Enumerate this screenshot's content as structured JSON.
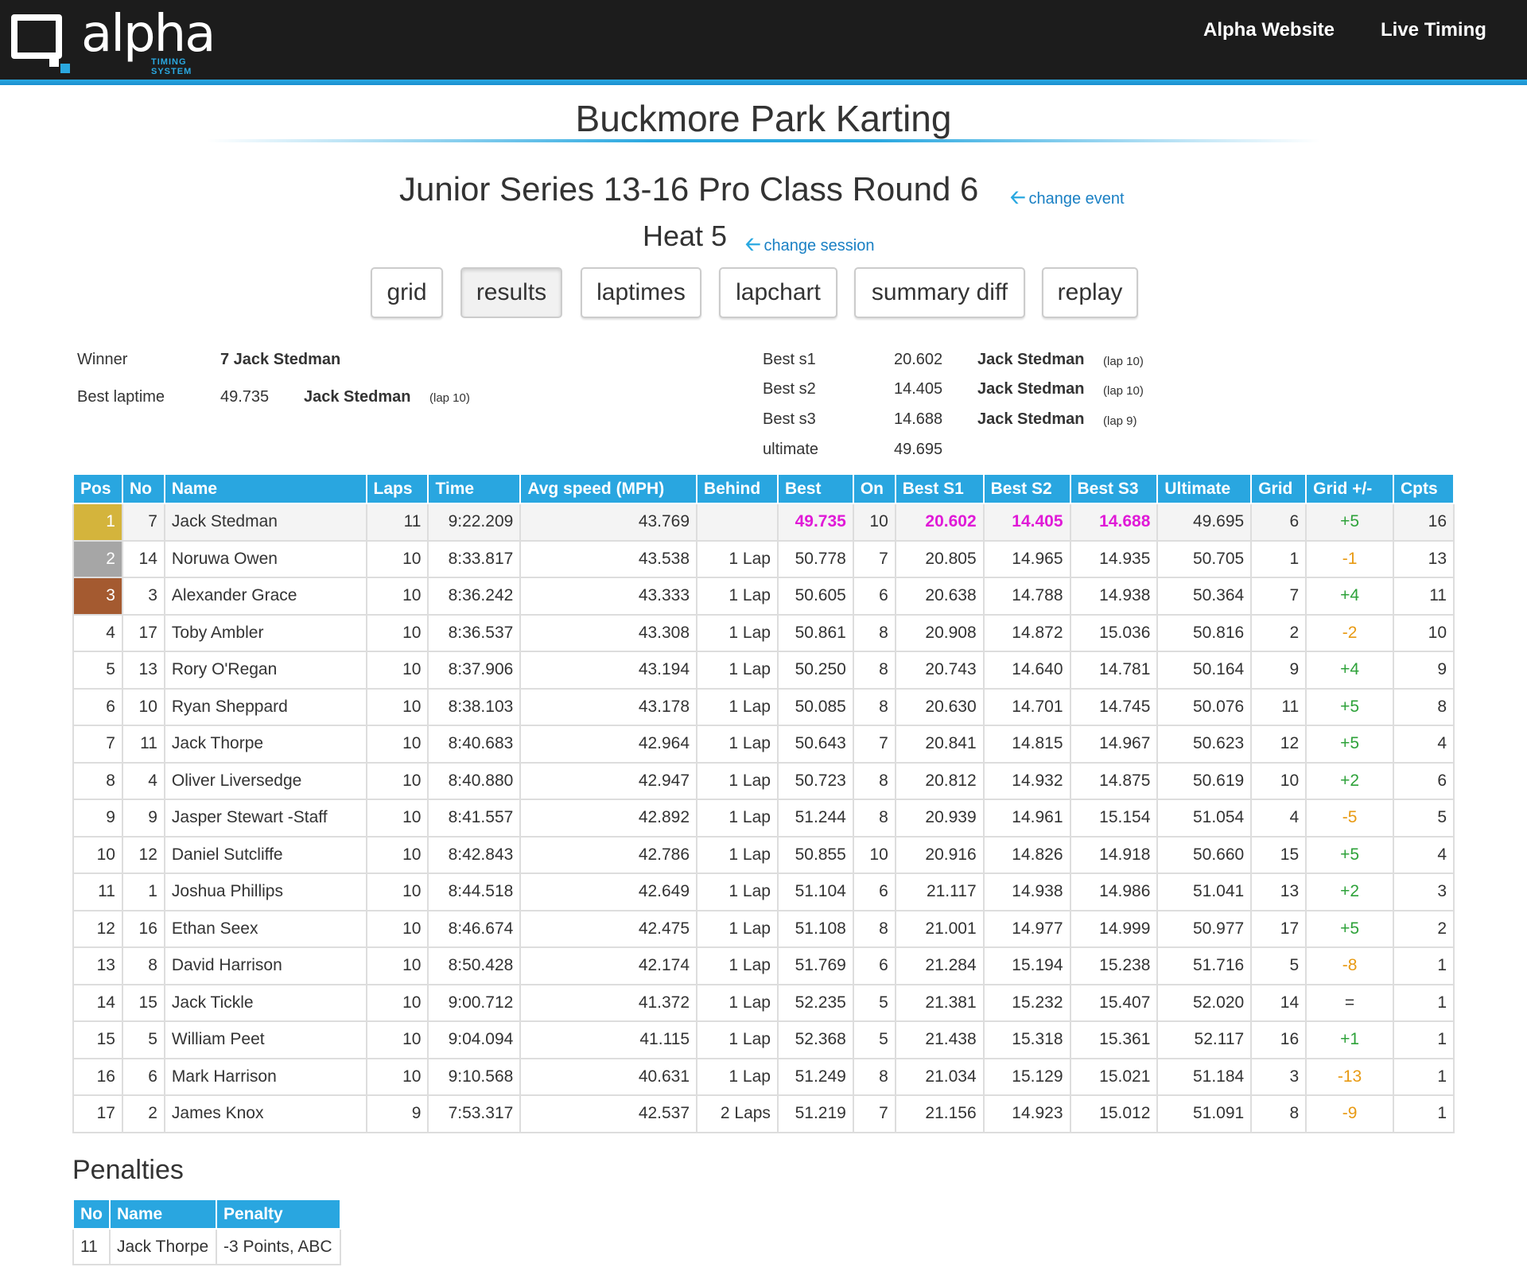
{
  "brand": {
    "logo_text": "alpha",
    "logo_subtext": "TIMING SYSTEM"
  },
  "nav": {
    "alpha_website": "Alpha Website",
    "live_timing": "Live Timing"
  },
  "venue": "Buckmore Park Karting",
  "event": {
    "title": "Junior Series 13-16 Pro Class Round 6",
    "change_label": "change event"
  },
  "session": {
    "title": "Heat 5",
    "change_label": "change session"
  },
  "tabs": [
    {
      "label": "grid",
      "active": false
    },
    {
      "label": "results",
      "active": true
    },
    {
      "label": "laptimes",
      "active": false
    },
    {
      "label": "lapchart",
      "active": false
    },
    {
      "label": "summary diff",
      "active": false
    },
    {
      "label": "replay",
      "active": false
    }
  ],
  "summary": {
    "winner_label": "Winner",
    "winner_value": "7 Jack Stedman",
    "best_laptime_label": "Best laptime",
    "best_laptime_value": "49.735",
    "best_laptime_driver": "Jack Stedman",
    "best_laptime_lap": "(lap 10)",
    "best_s1_label": "Best s1",
    "best_s1_value": "20.602",
    "best_s1_driver": "Jack Stedman",
    "best_s1_lap": "(lap 10)",
    "best_s2_label": "Best s2",
    "best_s2_value": "14.405",
    "best_s2_driver": "Jack Stedman",
    "best_s2_lap": "(lap 10)",
    "best_s3_label": "Best s3",
    "best_s3_value": "14.688",
    "best_s3_driver": "Jack Stedman",
    "best_s3_lap": "(lap 9)",
    "ultimate_label": "ultimate",
    "ultimate_value": "49.695"
  },
  "results": {
    "columns": [
      "Pos",
      "No",
      "Name",
      "Laps",
      "Time",
      "Avg speed (MPH)",
      "Behind",
      "Best",
      "On",
      "Best S1",
      "Best S2",
      "Best S3",
      "Ultimate",
      "Grid",
      "Grid +/-",
      "Cpts"
    ],
    "rows": [
      [
        "1",
        "7",
        "Jack Stedman",
        "11",
        "9:22.209",
        "43.769",
        "",
        "49.735",
        "10",
        "20.602",
        "14.405",
        "14.688",
        "49.695",
        "6",
        "+5",
        "16"
      ],
      [
        "2",
        "14",
        "Noruwa Owen",
        "10",
        "8:33.817",
        "43.538",
        "1 Lap",
        "50.778",
        "7",
        "20.805",
        "14.965",
        "14.935",
        "50.705",
        "1",
        "-1",
        "13"
      ],
      [
        "3",
        "3",
        "Alexander Grace",
        "10",
        "8:36.242",
        "43.333",
        "1 Lap",
        "50.605",
        "6",
        "20.638",
        "14.788",
        "14.938",
        "50.364",
        "7",
        "+4",
        "11"
      ],
      [
        "4",
        "17",
        "Toby Ambler",
        "10",
        "8:36.537",
        "43.308",
        "1 Lap",
        "50.861",
        "8",
        "20.908",
        "14.872",
        "15.036",
        "50.816",
        "2",
        "-2",
        "10"
      ],
      [
        "5",
        "13",
        "Rory O'Regan",
        "10",
        "8:37.906",
        "43.194",
        "1 Lap",
        "50.250",
        "8",
        "20.743",
        "14.640",
        "14.781",
        "50.164",
        "9",
        "+4",
        "9"
      ],
      [
        "6",
        "10",
        "Ryan Sheppard",
        "10",
        "8:38.103",
        "43.178",
        "1 Lap",
        "50.085",
        "8",
        "20.630",
        "14.701",
        "14.745",
        "50.076",
        "11",
        "+5",
        "8"
      ],
      [
        "7",
        "11",
        "Jack Thorpe",
        "10",
        "8:40.683",
        "42.964",
        "1 Lap",
        "50.643",
        "7",
        "20.841",
        "14.815",
        "14.967",
        "50.623",
        "12",
        "+5",
        "4"
      ],
      [
        "8",
        "4",
        "Oliver Liversedge",
        "10",
        "8:40.880",
        "42.947",
        "1 Lap",
        "50.723",
        "8",
        "20.812",
        "14.932",
        "14.875",
        "50.619",
        "10",
        "+2",
        "6"
      ],
      [
        "9",
        "9",
        "Jasper Stewart -Staff",
        "10",
        "8:41.557",
        "42.892",
        "1 Lap",
        "51.244",
        "8",
        "20.939",
        "14.961",
        "15.154",
        "51.054",
        "4",
        "-5",
        "5"
      ],
      [
        "10",
        "12",
        "Daniel Sutcliffe",
        "10",
        "8:42.843",
        "42.786",
        "1 Lap",
        "50.855",
        "10",
        "20.916",
        "14.826",
        "14.918",
        "50.660",
        "15",
        "+5",
        "4"
      ],
      [
        "11",
        "1",
        "Joshua Phillips",
        "10",
        "8:44.518",
        "42.649",
        "1 Lap",
        "51.104",
        "6",
        "21.117",
        "14.938",
        "14.986",
        "51.041",
        "13",
        "+2",
        "3"
      ],
      [
        "12",
        "16",
        "Ethan Seex",
        "10",
        "8:46.674",
        "42.475",
        "1 Lap",
        "51.108",
        "8",
        "21.001",
        "14.977",
        "14.999",
        "50.977",
        "17",
        "+5",
        "2"
      ],
      [
        "13",
        "8",
        "David Harrison",
        "10",
        "8:50.428",
        "42.174",
        "1 Lap",
        "51.769",
        "6",
        "21.284",
        "15.194",
        "15.238",
        "51.716",
        "5",
        "-8",
        "1"
      ],
      [
        "14",
        "15",
        "Jack Tickle",
        "10",
        "9:00.712",
        "41.372",
        "1 Lap",
        "52.235",
        "5",
        "21.381",
        "15.232",
        "15.407",
        "52.020",
        "14",
        "=",
        "1"
      ],
      [
        "15",
        "5",
        "William Peet",
        "10",
        "9:04.094",
        "41.115",
        "1 Lap",
        "52.368",
        "5",
        "21.438",
        "15.318",
        "15.361",
        "52.117",
        "16",
        "+1",
        "1"
      ],
      [
        "16",
        "6",
        "Mark Harrison",
        "10",
        "9:10.568",
        "40.631",
        "1 Lap",
        "51.249",
        "8",
        "21.034",
        "15.129",
        "15.021",
        "51.184",
        "3",
        "-13",
        "1"
      ],
      [
        "17",
        "2",
        "James Knox",
        "9",
        "7:53.317",
        "42.537",
        "2 Laps",
        "51.219",
        "7",
        "21.156",
        "14.923",
        "15.012",
        "51.091",
        "8",
        "-9",
        "1"
      ]
    ]
  },
  "penalties": {
    "title": "Penalties",
    "columns": [
      "No",
      "Name",
      "Penalty"
    ],
    "rows": [
      [
        "11",
        "Jack Thorpe",
        "-3 Points, ABC"
      ]
    ]
  },
  "colors": {
    "accent": "#29a6e0",
    "gold": "#d4b43c",
    "silver": "#a6a6a6",
    "bronze": "#a45a30",
    "best_purple": "#e01ad7",
    "gain_green": "#2ea23a",
    "loss_orange": "#e89a13"
  }
}
